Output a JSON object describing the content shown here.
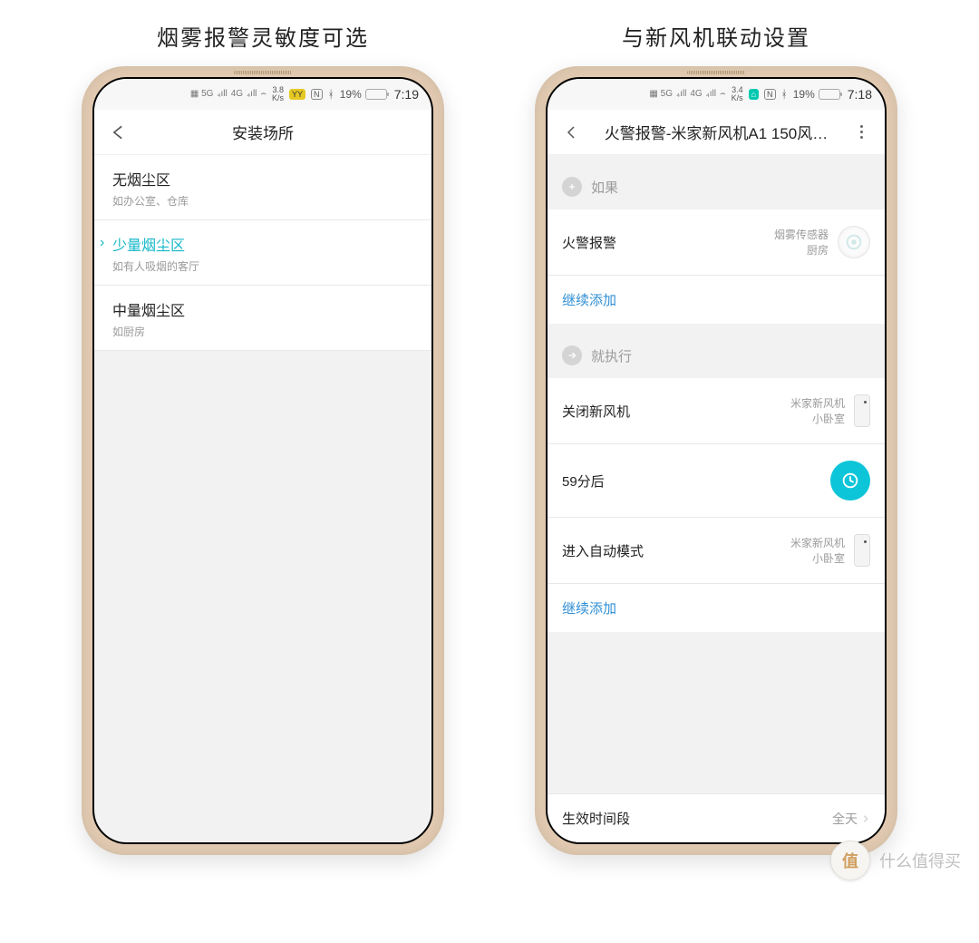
{
  "captions": {
    "left": "烟雾报警灵敏度可选",
    "right": "与新风机联动设置"
  },
  "watermark": {
    "badge": "值",
    "text": "什么值得买"
  },
  "left": {
    "status": {
      "speed": "3.8",
      "speed_unit": "K/s",
      "battery": "19%",
      "time": "7:19",
      "chip_text": "YY"
    },
    "title": "安装场所",
    "options": [
      {
        "title": "无烟尘区",
        "sub": "如办公室、仓库",
        "selected": false
      },
      {
        "title": "少量烟尘区",
        "sub": "如有人吸烟的客厅",
        "selected": true
      },
      {
        "title": "中量烟尘区",
        "sub": "如厨房",
        "selected": false
      }
    ]
  },
  "right": {
    "status": {
      "speed": "3.4",
      "speed_unit": "K/s",
      "battery": "19%",
      "time": "7:18",
      "chip_text": "⌂"
    },
    "title": "火警报警-米家新风机A1 150风…",
    "if_label": "如果",
    "then_label": "就执行",
    "add_more": "继续添加",
    "if_items": [
      {
        "name": "火警报警",
        "sub1": "烟雾传感器",
        "sub2": "厨房",
        "icon": "smoke"
      }
    ],
    "then_items": [
      {
        "name": "关闭新风机",
        "sub1": "米家新风机",
        "sub2": "小卧室",
        "icon": "fresh"
      },
      {
        "name": "59分后",
        "icon": "timer"
      },
      {
        "name": "进入自动模式",
        "sub1": "米家新风机",
        "sub2": "小卧室",
        "icon": "fresh"
      }
    ],
    "footer": {
      "label": "生效时间段",
      "value": "全天"
    }
  }
}
